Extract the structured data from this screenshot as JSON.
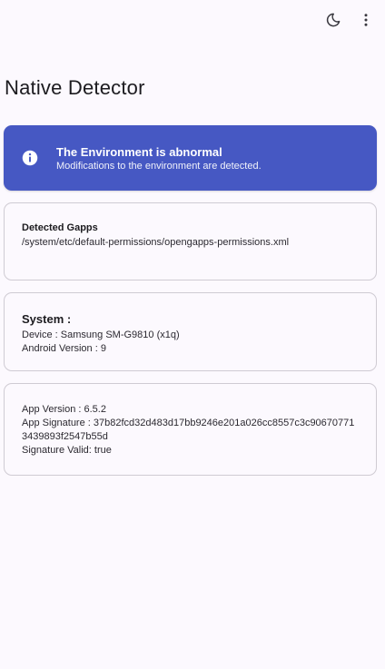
{
  "toolbar": {
    "theme_icon": "moon-icon",
    "menu_icon": "more-vert-icon"
  },
  "page": {
    "title": "Native Detector"
  },
  "alert": {
    "icon": "info-icon",
    "title": "The Environment is abnormal",
    "subtitle": "Modifications to the environment are detected.",
    "color": "#4658c3"
  },
  "gapps": {
    "title": "Detected Gapps",
    "path": "/system/etc/default-permissions/opengapps-permissions.xml"
  },
  "system": {
    "title": "System :",
    "device": "Device : Samsung SM-G9810  (x1q)",
    "android_version": "Android Version : 9"
  },
  "app": {
    "version": "App Version : 6.5.2",
    "signature": "App Signature : 37b82fcd32d483d17bb9246e201a026cc8557c3c906707713439893f2547b55d",
    "signature_valid": "Signature Valid: true"
  }
}
